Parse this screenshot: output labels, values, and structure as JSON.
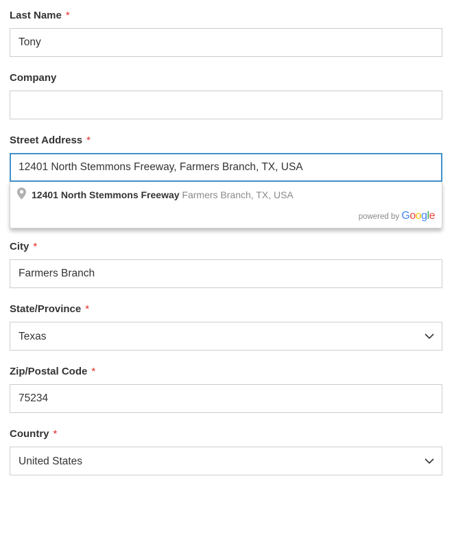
{
  "lastName": {
    "label": "Last Name",
    "required": true,
    "value": "Tony"
  },
  "company": {
    "label": "Company",
    "required": false,
    "value": ""
  },
  "street": {
    "label": "Street Address",
    "required": true,
    "value": "12401 North Stemmons Freeway, Farmers Branch, TX, USA",
    "autocomplete": {
      "suggestions": [
        {
          "main": "12401 North Stemmons Freeway",
          "secondary": "Farmers Branch, TX, USA"
        }
      ],
      "poweredByText": "powered by",
      "poweredByBrand": "Google"
    }
  },
  "street2": {
    "value": ""
  },
  "city": {
    "label": "City",
    "required": true,
    "value": "Farmers Branch"
  },
  "state": {
    "label": "State/Province",
    "required": true,
    "value": "Texas"
  },
  "zip": {
    "label": "Zip/Postal Code",
    "required": true,
    "value": "75234"
  },
  "country": {
    "label": "Country",
    "required": true,
    "value": "United States"
  },
  "requiredMark": "*"
}
